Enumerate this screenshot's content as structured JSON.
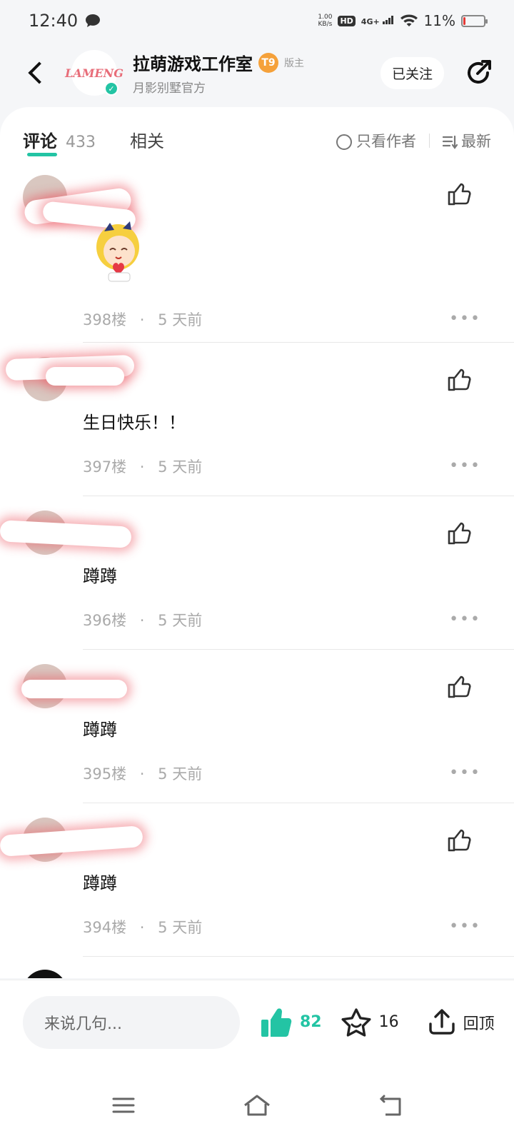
{
  "status_bar": {
    "time": "12:40",
    "net_speed_value": "1.00",
    "net_speed_unit": "KB/s",
    "hd": "HD",
    "signal": "4G+",
    "battery": "11%",
    "battery_level": 0.11
  },
  "header": {
    "title": "拉萌游戏工作室",
    "level": "T9",
    "role": "版主",
    "subtitle": "月影别墅官方",
    "logo_text": "LAMENG",
    "follow_label": "已关注"
  },
  "tabs": [
    {
      "label": "评论",
      "count": "433"
    },
    {
      "label": "相关"
    }
  ],
  "filters": {
    "author_only": "只看作者",
    "sort": "最新"
  },
  "comments": [
    {
      "text": "",
      "floor": "398楼",
      "time": "5 天前",
      "has_sticker": true
    },
    {
      "text": "生日快乐！！",
      "floor": "397楼",
      "time": "5 天前"
    },
    {
      "text": "蹲蹲",
      "floor": "396楼",
      "time": "5 天前"
    },
    {
      "text": "蹲蹲",
      "floor": "395楼",
      "time": "5 天前"
    },
    {
      "text": "蹲蹲",
      "floor": "394楼",
      "time": "5 天前"
    }
  ],
  "comment_meta_sep": "·",
  "bottom_bar": {
    "input_placeholder": "来说几句...",
    "likes": "82",
    "favorites": "16",
    "top_label": "回顶"
  },
  "colors": {
    "accent": "#23c4a4",
    "meta_gray": "#aaaaaa"
  }
}
